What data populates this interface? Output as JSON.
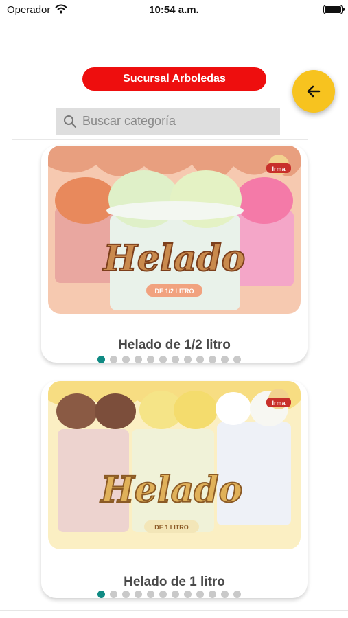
{
  "status_bar": {
    "carrier": "Operador",
    "time": "10:54 a.m."
  },
  "header": {
    "branch_label": "Sucursal Arboledas"
  },
  "search": {
    "placeholder": "Buscar categoría"
  },
  "products": [
    {
      "title": "Helado de 1/2 litro",
      "badge": "DE 1/2 LITRO",
      "brand": "Irma",
      "dots": 12,
      "active_dot": 0
    },
    {
      "title": "Helado de 1 litro",
      "badge": "DE 1 LITRO",
      "brand": "Irma",
      "dots": 12,
      "active_dot": 0
    }
  ],
  "colors": {
    "brand_red": "#ee0e0e",
    "fab_yellow": "#f7c31f",
    "active_dot": "#0f8a83"
  },
  "icons": [
    "wifi-icon",
    "battery-icon",
    "arrow-left-icon",
    "search-icon"
  ]
}
